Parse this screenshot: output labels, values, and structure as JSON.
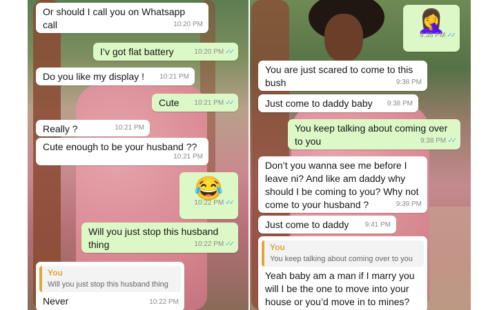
{
  "left": {
    "messages": [
      {
        "text": "Or should I call you on Whatsapp call",
        "time": "10:20 PM"
      },
      {
        "text": "I’v got flat battery",
        "time": "10:20 PM"
      },
      {
        "text": "Do you like my display !",
        "time": "10:21 PM"
      },
      {
        "text": "Cute",
        "time": "10:21 PM"
      },
      {
        "text": "Really ?",
        "time": "10:21 PM"
      },
      {
        "text": "Cute enough to be your husband ??",
        "time": "10:21 PM"
      },
      {
        "text": "😂",
        "time": "10:22 PM"
      },
      {
        "text": "Will you just stop this husband thing",
        "time": "10:22 PM"
      },
      {
        "quote_author": "You",
        "quote_text": "Will you just stop this husband thing",
        "text": "Never",
        "time": "10:22 PM"
      }
    ]
  },
  "right": {
    "messages": [
      {
        "text": "🤦‍♀️",
        "time": "9:38 PM"
      },
      {
        "text": "You are just scared to come to this bush",
        "time": "9:38 PM"
      },
      {
        "text": "Just come to daddy baby",
        "time": "9:38 PM"
      },
      {
        "text": "You keep talking about coming over to you",
        "time": "9:38 PM"
      },
      {
        "text": "Don’t you wanna see me before I leave ni? And like am daddy why should I be coming to you? Why not come to your husband ?",
        "time": "9:39 PM"
      },
      {
        "text": "Just come to daddy",
        "time": "9:41 PM"
      },
      {
        "quote_author": "You",
        "quote_text": "You keep talking about coming over to you",
        "text": "Yeah baby am a man if I marry you will I be the one to move into your house or you’d move in to mines?",
        "time": ""
      }
    ]
  },
  "colors": {
    "incoming": "#ffffff",
    "outgoing": "#dcf8c6",
    "read_ticks": "#4fb6ec",
    "quote_accent": "#e3a43a"
  },
  "icons": {
    "read_receipt": "double-check-icon"
  }
}
